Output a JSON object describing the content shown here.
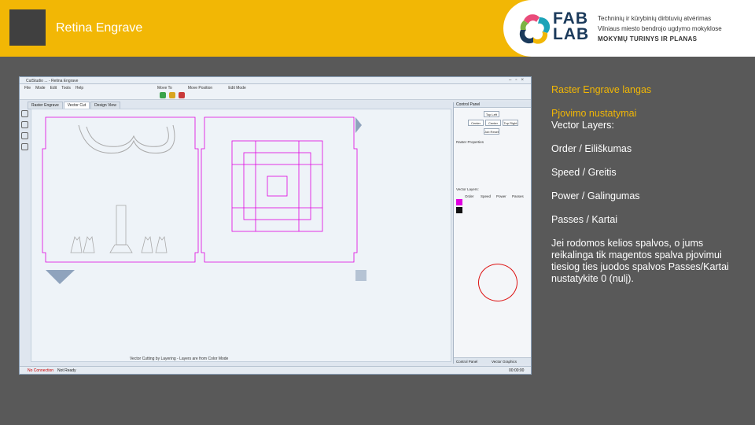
{
  "header": {
    "title": "Retina Engrave",
    "brand_line1": "FAB",
    "brand_line2": "LAB",
    "line1": "Techninių ir kūrybinių dirbtuvių atvėrimas",
    "line2": "Vilniaus miesto bendrojo ugdymo mokyklose",
    "line3": "MOKYMŲ TURINYS IR PLANAS"
  },
  "app": {
    "window_title": "CutStudio ... - Retina Engrave",
    "menu": [
      "File",
      "Mode",
      "Edit",
      "Tools",
      "Help"
    ],
    "toolbar": [
      "Move To",
      "Move Position",
      "Edit Mode"
    ],
    "tabs": [
      "Raster Engrave",
      "Vector Cut",
      "Design View"
    ],
    "active_tab": "Vector Cut",
    "canvas_note": "Vector Cutting by Layering - Layers are from Color Mode",
    "status_left": "No Connection",
    "status_mid": "Not Ready",
    "panel": {
      "title": "Control Panel",
      "btn_top": "Top Left",
      "btn_center": "Center",
      "btn_right": "Top Right",
      "btn_reset": "Job Reset",
      "raster_props": "Raster Properties",
      "vector_layers": "Vector Layers:",
      "cols": [
        "Order",
        "Speed",
        "Power",
        "Passes"
      ],
      "bottom_tabs": [
        "Control Panel",
        "Vector Graphics"
      ]
    },
    "layer_colors": [
      "#e000e0",
      "#111111"
    ],
    "time": "00:00:00"
  },
  "notes": {
    "n1": "Raster Engrave langas",
    "n2": "Pjovimo nustatymai",
    "n3": "Vector Layers:",
    "n4": "Order / Eiliškumas",
    "n5": "Speed / Greitis",
    "n6": "Power / Galingumas",
    "n7": "Passes / Kartai",
    "n8": "Jei rodomos kelios spalvos, o jums reikalinga tik magentos spalva pjovimui tiesiog ties juodos spalvos Passes/Kartai nustatykite 0 (nulį)."
  },
  "colors": {
    "accent": "#f2b705",
    "background": "#595959",
    "cut_magenta": "#e000e0"
  }
}
